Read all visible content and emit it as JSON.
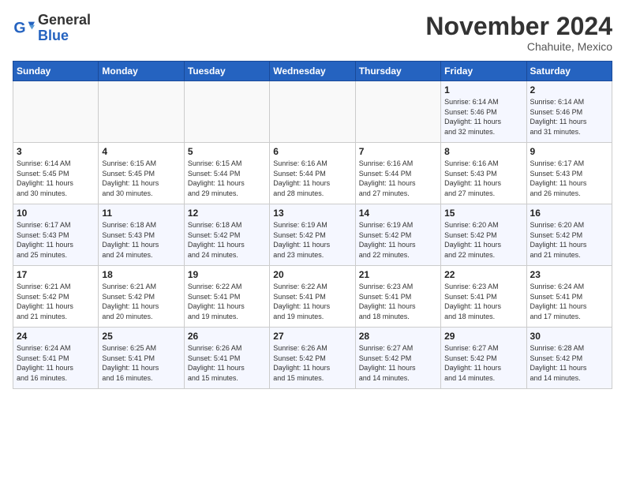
{
  "logo": {
    "general": "General",
    "blue": "Blue"
  },
  "title": "November 2024",
  "location": "Chahuite, Mexico",
  "days_header": [
    "Sunday",
    "Monday",
    "Tuesday",
    "Wednesday",
    "Thursday",
    "Friday",
    "Saturday"
  ],
  "weeks": [
    [
      {
        "day": "",
        "info": ""
      },
      {
        "day": "",
        "info": ""
      },
      {
        "day": "",
        "info": ""
      },
      {
        "day": "",
        "info": ""
      },
      {
        "day": "",
        "info": ""
      },
      {
        "day": "1",
        "info": "Sunrise: 6:14 AM\nSunset: 5:46 PM\nDaylight: 11 hours\nand 32 minutes."
      },
      {
        "day": "2",
        "info": "Sunrise: 6:14 AM\nSunset: 5:46 PM\nDaylight: 11 hours\nand 31 minutes."
      }
    ],
    [
      {
        "day": "3",
        "info": "Sunrise: 6:14 AM\nSunset: 5:45 PM\nDaylight: 11 hours\nand 30 minutes."
      },
      {
        "day": "4",
        "info": "Sunrise: 6:15 AM\nSunset: 5:45 PM\nDaylight: 11 hours\nand 30 minutes."
      },
      {
        "day": "5",
        "info": "Sunrise: 6:15 AM\nSunset: 5:44 PM\nDaylight: 11 hours\nand 29 minutes."
      },
      {
        "day": "6",
        "info": "Sunrise: 6:16 AM\nSunset: 5:44 PM\nDaylight: 11 hours\nand 28 minutes."
      },
      {
        "day": "7",
        "info": "Sunrise: 6:16 AM\nSunset: 5:44 PM\nDaylight: 11 hours\nand 27 minutes."
      },
      {
        "day": "8",
        "info": "Sunrise: 6:16 AM\nSunset: 5:43 PM\nDaylight: 11 hours\nand 27 minutes."
      },
      {
        "day": "9",
        "info": "Sunrise: 6:17 AM\nSunset: 5:43 PM\nDaylight: 11 hours\nand 26 minutes."
      }
    ],
    [
      {
        "day": "10",
        "info": "Sunrise: 6:17 AM\nSunset: 5:43 PM\nDaylight: 11 hours\nand 25 minutes."
      },
      {
        "day": "11",
        "info": "Sunrise: 6:18 AM\nSunset: 5:43 PM\nDaylight: 11 hours\nand 24 minutes."
      },
      {
        "day": "12",
        "info": "Sunrise: 6:18 AM\nSunset: 5:42 PM\nDaylight: 11 hours\nand 24 minutes."
      },
      {
        "day": "13",
        "info": "Sunrise: 6:19 AM\nSunset: 5:42 PM\nDaylight: 11 hours\nand 23 minutes."
      },
      {
        "day": "14",
        "info": "Sunrise: 6:19 AM\nSunset: 5:42 PM\nDaylight: 11 hours\nand 22 minutes."
      },
      {
        "day": "15",
        "info": "Sunrise: 6:20 AM\nSunset: 5:42 PM\nDaylight: 11 hours\nand 22 minutes."
      },
      {
        "day": "16",
        "info": "Sunrise: 6:20 AM\nSunset: 5:42 PM\nDaylight: 11 hours\nand 21 minutes."
      }
    ],
    [
      {
        "day": "17",
        "info": "Sunrise: 6:21 AM\nSunset: 5:42 PM\nDaylight: 11 hours\nand 21 minutes."
      },
      {
        "day": "18",
        "info": "Sunrise: 6:21 AM\nSunset: 5:42 PM\nDaylight: 11 hours\nand 20 minutes."
      },
      {
        "day": "19",
        "info": "Sunrise: 6:22 AM\nSunset: 5:41 PM\nDaylight: 11 hours\nand 19 minutes."
      },
      {
        "day": "20",
        "info": "Sunrise: 6:22 AM\nSunset: 5:41 PM\nDaylight: 11 hours\nand 19 minutes."
      },
      {
        "day": "21",
        "info": "Sunrise: 6:23 AM\nSunset: 5:41 PM\nDaylight: 11 hours\nand 18 minutes."
      },
      {
        "day": "22",
        "info": "Sunrise: 6:23 AM\nSunset: 5:41 PM\nDaylight: 11 hours\nand 18 minutes."
      },
      {
        "day": "23",
        "info": "Sunrise: 6:24 AM\nSunset: 5:41 PM\nDaylight: 11 hours\nand 17 minutes."
      }
    ],
    [
      {
        "day": "24",
        "info": "Sunrise: 6:24 AM\nSunset: 5:41 PM\nDaylight: 11 hours\nand 16 minutes."
      },
      {
        "day": "25",
        "info": "Sunrise: 6:25 AM\nSunset: 5:41 PM\nDaylight: 11 hours\nand 16 minutes."
      },
      {
        "day": "26",
        "info": "Sunrise: 6:26 AM\nSunset: 5:41 PM\nDaylight: 11 hours\nand 15 minutes."
      },
      {
        "day": "27",
        "info": "Sunrise: 6:26 AM\nSunset: 5:42 PM\nDaylight: 11 hours\nand 15 minutes."
      },
      {
        "day": "28",
        "info": "Sunrise: 6:27 AM\nSunset: 5:42 PM\nDaylight: 11 hours\nand 14 minutes."
      },
      {
        "day": "29",
        "info": "Sunrise: 6:27 AM\nSunset: 5:42 PM\nDaylight: 11 hours\nand 14 minutes."
      },
      {
        "day": "30",
        "info": "Sunrise: 6:28 AM\nSunset: 5:42 PM\nDaylight: 11 hours\nand 14 minutes."
      }
    ]
  ]
}
